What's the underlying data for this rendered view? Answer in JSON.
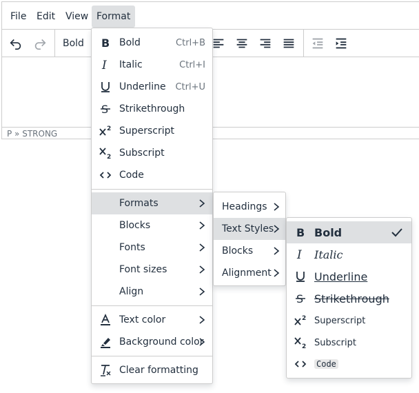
{
  "menubar": {
    "items": [
      {
        "label": "File"
      },
      {
        "label": "Edit"
      },
      {
        "label": "View"
      },
      {
        "label": "Format"
      }
    ]
  },
  "toolbar": {
    "block_format": "Bold"
  },
  "statusbar": {
    "path": "P » STRONG"
  },
  "format_menu": {
    "items": [
      {
        "label": "Bold",
        "shortcut": "Ctrl+B",
        "icon": "bold-icon"
      },
      {
        "label": "Italic",
        "shortcut": "Ctrl+I",
        "icon": "italic-icon"
      },
      {
        "label": "Underline",
        "shortcut": "Ctrl+U",
        "icon": "underline-icon"
      },
      {
        "label": "Strikethrough",
        "icon": "strikethrough-icon"
      },
      {
        "label": "Superscript",
        "icon": "superscript-icon"
      },
      {
        "label": "Subscript",
        "icon": "subscript-icon"
      },
      {
        "label": "Code",
        "icon": "code-icon"
      },
      {
        "label": "Formats"
      },
      {
        "label": "Blocks"
      },
      {
        "label": "Fonts"
      },
      {
        "label": "Font sizes"
      },
      {
        "label": "Align"
      },
      {
        "label": "Text color",
        "icon": "text-color-icon"
      },
      {
        "label": "Background color",
        "icon": "highlight-icon"
      },
      {
        "label": "Clear formatting",
        "icon": "clear-formatting-icon"
      }
    ]
  },
  "formats_menu": {
    "items": [
      {
        "label": "Headings"
      },
      {
        "label": "Text Styles"
      },
      {
        "label": "Blocks"
      },
      {
        "label": "Alignment"
      }
    ]
  },
  "text_styles_menu": {
    "items": [
      {
        "label": "Bold",
        "checked": true
      },
      {
        "label": "Italic"
      },
      {
        "label": "Underline"
      },
      {
        "label": "Strikethrough"
      },
      {
        "label": "Superscript"
      },
      {
        "label": "Subscript"
      },
      {
        "label": "Code"
      }
    ]
  },
  "colors": {
    "highlight": "#dee0e2",
    "text": "#222f3e",
    "muted": "#6a737c",
    "border": "#cccccc"
  }
}
